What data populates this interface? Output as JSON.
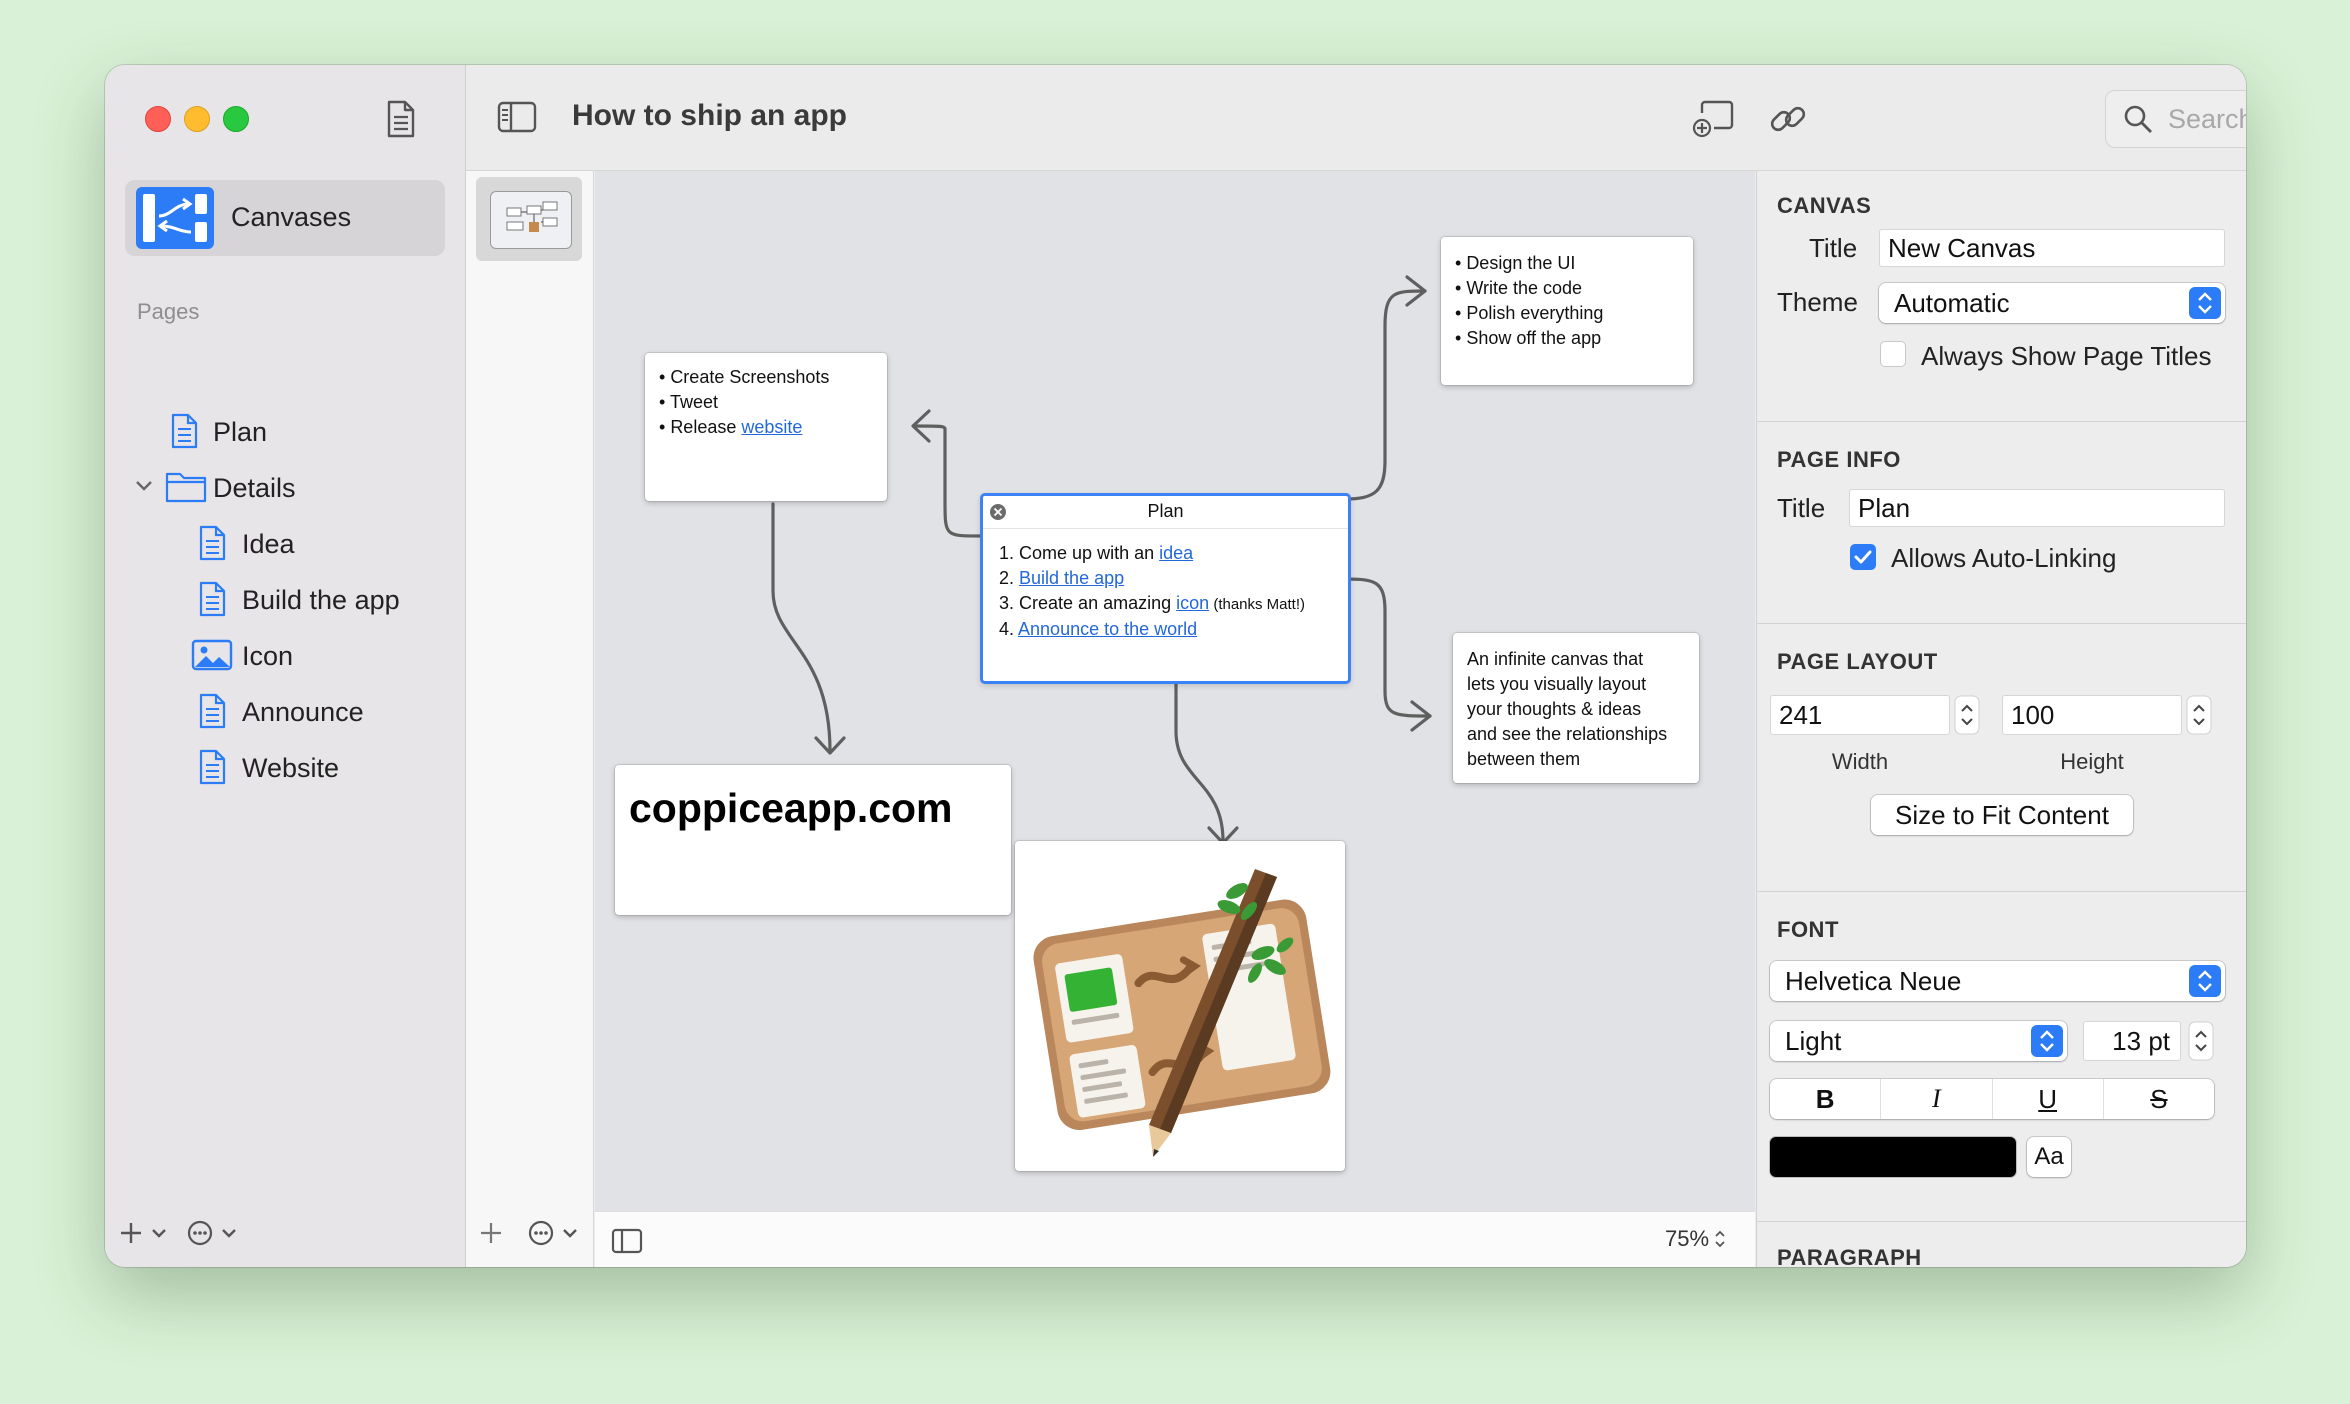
{
  "window": {
    "title": "How to ship an app"
  },
  "search": {
    "placeholder": "Search"
  },
  "sidebar": {
    "canvases_label": "Canvases",
    "pages_section": "Pages",
    "items": [
      {
        "label": "Plan",
        "icon": "document-icon",
        "indent": 0
      },
      {
        "label": "Details",
        "icon": "folder-icon",
        "indent": 0,
        "expanded": true
      },
      {
        "label": "Idea",
        "icon": "document-icon",
        "indent": 1
      },
      {
        "label": "Build the app",
        "icon": "document-icon",
        "indent": 1
      },
      {
        "label": "Icon",
        "icon": "image-icon",
        "indent": 1
      },
      {
        "label": "Announce",
        "icon": "document-icon",
        "indent": 1
      },
      {
        "label": "Website",
        "icon": "document-icon",
        "indent": 1
      }
    ]
  },
  "canvas": {
    "cards": {
      "release": {
        "lines": [
          "Create Screenshots",
          "Tweet",
          "Release "
        ],
        "link": "website"
      },
      "design": {
        "lines": [
          "Design the UI",
          "Write the code",
          "Polish everything",
          "Show off the app"
        ]
      },
      "plan": {
        "title": "Plan",
        "items": [
          {
            "num": "1.",
            "text": "Come up with an ",
            "link": "idea",
            "after": ""
          },
          {
            "num": "2.",
            "text": "",
            "link": "Build the app",
            "after": ""
          },
          {
            "num": "3.",
            "text": "Create an amazing ",
            "link": "icon",
            "after": " (thanks Matt!)"
          },
          {
            "num": "4.",
            "text": "",
            "link": "Announce to the world",
            "after": ""
          }
        ]
      },
      "infinite": {
        "text": [
          "An infinite canvas that",
          "lets you visually layout",
          "your thoughts & ideas",
          "and see the relationships",
          "between them"
        ]
      },
      "website": {
        "text": "coppiceapp.com"
      },
      "app_icon": {
        "icon": "coppice-app-icon"
      }
    },
    "zoom": "75%"
  },
  "inspector": {
    "canvas": {
      "heading": "CANVAS",
      "title_label": "Title",
      "title_value": "New Canvas",
      "theme_label": "Theme",
      "theme_value": "Automatic",
      "always_show_label": "Always Show Page Titles",
      "always_show_checked": false
    },
    "page_info": {
      "heading": "PAGE INFO",
      "title_label": "Title",
      "title_value": "Plan",
      "auto_link_label": "Allows Auto-Linking",
      "auto_link_checked": true
    },
    "page_layout": {
      "heading": "PAGE LAYOUT",
      "width_value": "241",
      "height_value": "100",
      "width_label": "Width",
      "height_label": "Height",
      "fit_button": "Size to Fit Content"
    },
    "font": {
      "heading": "FONT",
      "family": "Helvetica Neue",
      "style": "Light",
      "size": "13 pt",
      "bold": "B",
      "italic": "I",
      "underline": "U",
      "strike": "S",
      "color": "#000000",
      "aa_label": "Aa"
    },
    "paragraph": {
      "heading": "PARAGRAPH"
    }
  },
  "colors": {
    "accent": "#2b7cf6",
    "link": "#2368d8",
    "close": "#ff5f57",
    "minimize": "#febc2e",
    "zoom": "#28c840"
  }
}
